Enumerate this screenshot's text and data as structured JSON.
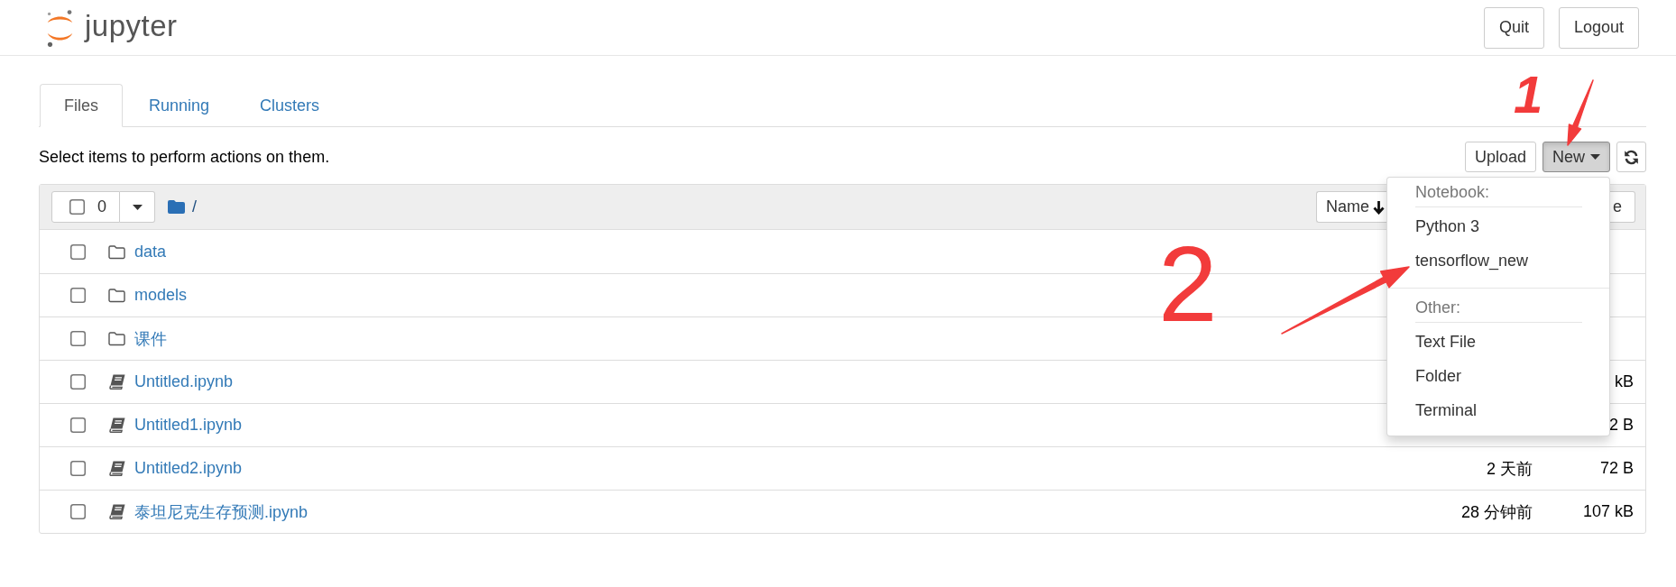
{
  "header": {
    "logo_text": "jupyter",
    "buttons": [
      "Quit",
      "Logout"
    ]
  },
  "tabs": [
    {
      "label": "Files",
      "selected": true
    },
    {
      "label": "Running",
      "selected": false
    },
    {
      "label": "Clusters",
      "selected": false
    }
  ],
  "hint": "Select items to perform actions on them.",
  "toolbar": [
    {
      "kind": "button",
      "label": "Upload",
      "pressed": false
    },
    {
      "kind": "dropdown",
      "label": "New",
      "pressed": true
    },
    {
      "kind": "refresh",
      "pressed": false
    }
  ],
  "new_menu": {
    "sections": [
      {
        "heading": "Notebook:",
        "items": [
          "Python 3",
          "tensorflow_new"
        ]
      },
      {
        "heading": "Other:",
        "items": [
          "Text File",
          "Folder",
          "Terminal"
        ]
      }
    ]
  },
  "list_header": {
    "select_all": {
      "checked": false,
      "count": "0"
    },
    "path": "/",
    "sort_buttons": [
      {
        "label": "Name",
        "sorted": true
      },
      {
        "label": "e",
        "sorted": false
      }
    ]
  },
  "rows": [
    {
      "kind": "folder",
      "name": "data",
      "checked": false
    },
    {
      "kind": "folder",
      "name": "models",
      "checked": false
    },
    {
      "kind": "folder",
      "name": "课件",
      "checked": false
    },
    {
      "kind": "notebook",
      "name": "Untitled.ipynb",
      "size": "kB",
      "checked": false
    },
    {
      "kind": "notebook",
      "name": "Untitled1.ipynb",
      "size": "2 B",
      "checked": false
    },
    {
      "kind": "notebook",
      "name": "Untitled2.ipynb",
      "modified": "2 天前",
      "size": "72 B",
      "checked": false
    },
    {
      "kind": "notebook",
      "name": "泰坦尼克生存预测.ipynb",
      "modified": "28 分钟前",
      "size": "107 kB",
      "checked": false
    }
  ],
  "annotations": [
    {
      "label": "1"
    },
    {
      "label": "2"
    }
  ]
}
